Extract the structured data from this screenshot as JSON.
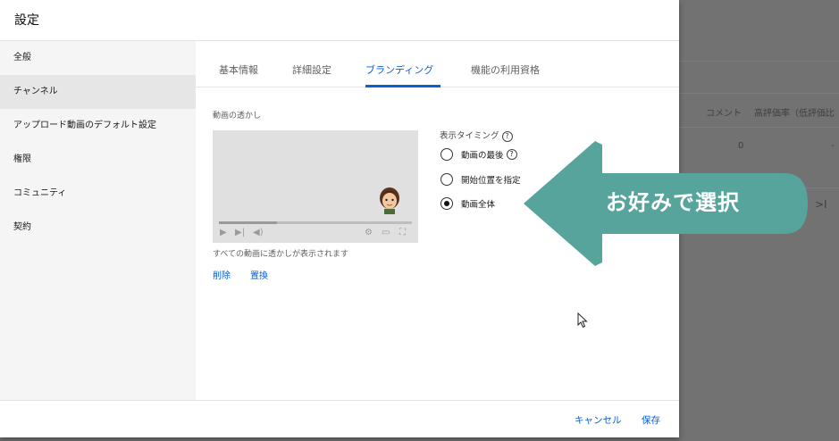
{
  "dialog": {
    "title": "設定",
    "sidebar": [
      {
        "label": "全般",
        "active": false
      },
      {
        "label": "チャンネル",
        "active": true
      },
      {
        "label": "アップロード動画のデフォルト設定",
        "active": false
      },
      {
        "label": "権限",
        "active": false
      },
      {
        "label": "コミュニティ",
        "active": false
      },
      {
        "label": "契約",
        "active": false
      }
    ],
    "tabs": [
      {
        "label": "基本情報",
        "active": false
      },
      {
        "label": "詳細設定",
        "active": false
      },
      {
        "label": "ブランディング",
        "active": true
      },
      {
        "label": "機能の利用資格",
        "active": false
      }
    ],
    "watermark": {
      "section_label": "動画の透かし",
      "note": "すべての動画に透かしが表示されます",
      "remove_label": "削除",
      "replace_label": "置換",
      "player_progress": 0.3
    },
    "timing": {
      "title": "表示タイミング",
      "options": [
        {
          "label": "動画の最後",
          "selected": false,
          "has_help": true
        },
        {
          "label": "開始位置を指定",
          "selected": false,
          "has_help": false
        },
        {
          "label": "動画全体",
          "selected": true,
          "has_help": false
        }
      ]
    },
    "footer": {
      "cancel_label": "キャンセル",
      "save_label": "保存"
    }
  },
  "background": {
    "columns": [
      "コメント",
      "高評価率（低評価比"
    ],
    "row_value": "0",
    "row_dash": "-",
    "pager": ">I"
  },
  "annotation": {
    "text": "お好みで選択",
    "color": "#56a49b"
  },
  "colors": {
    "accent": "#065fd4"
  }
}
